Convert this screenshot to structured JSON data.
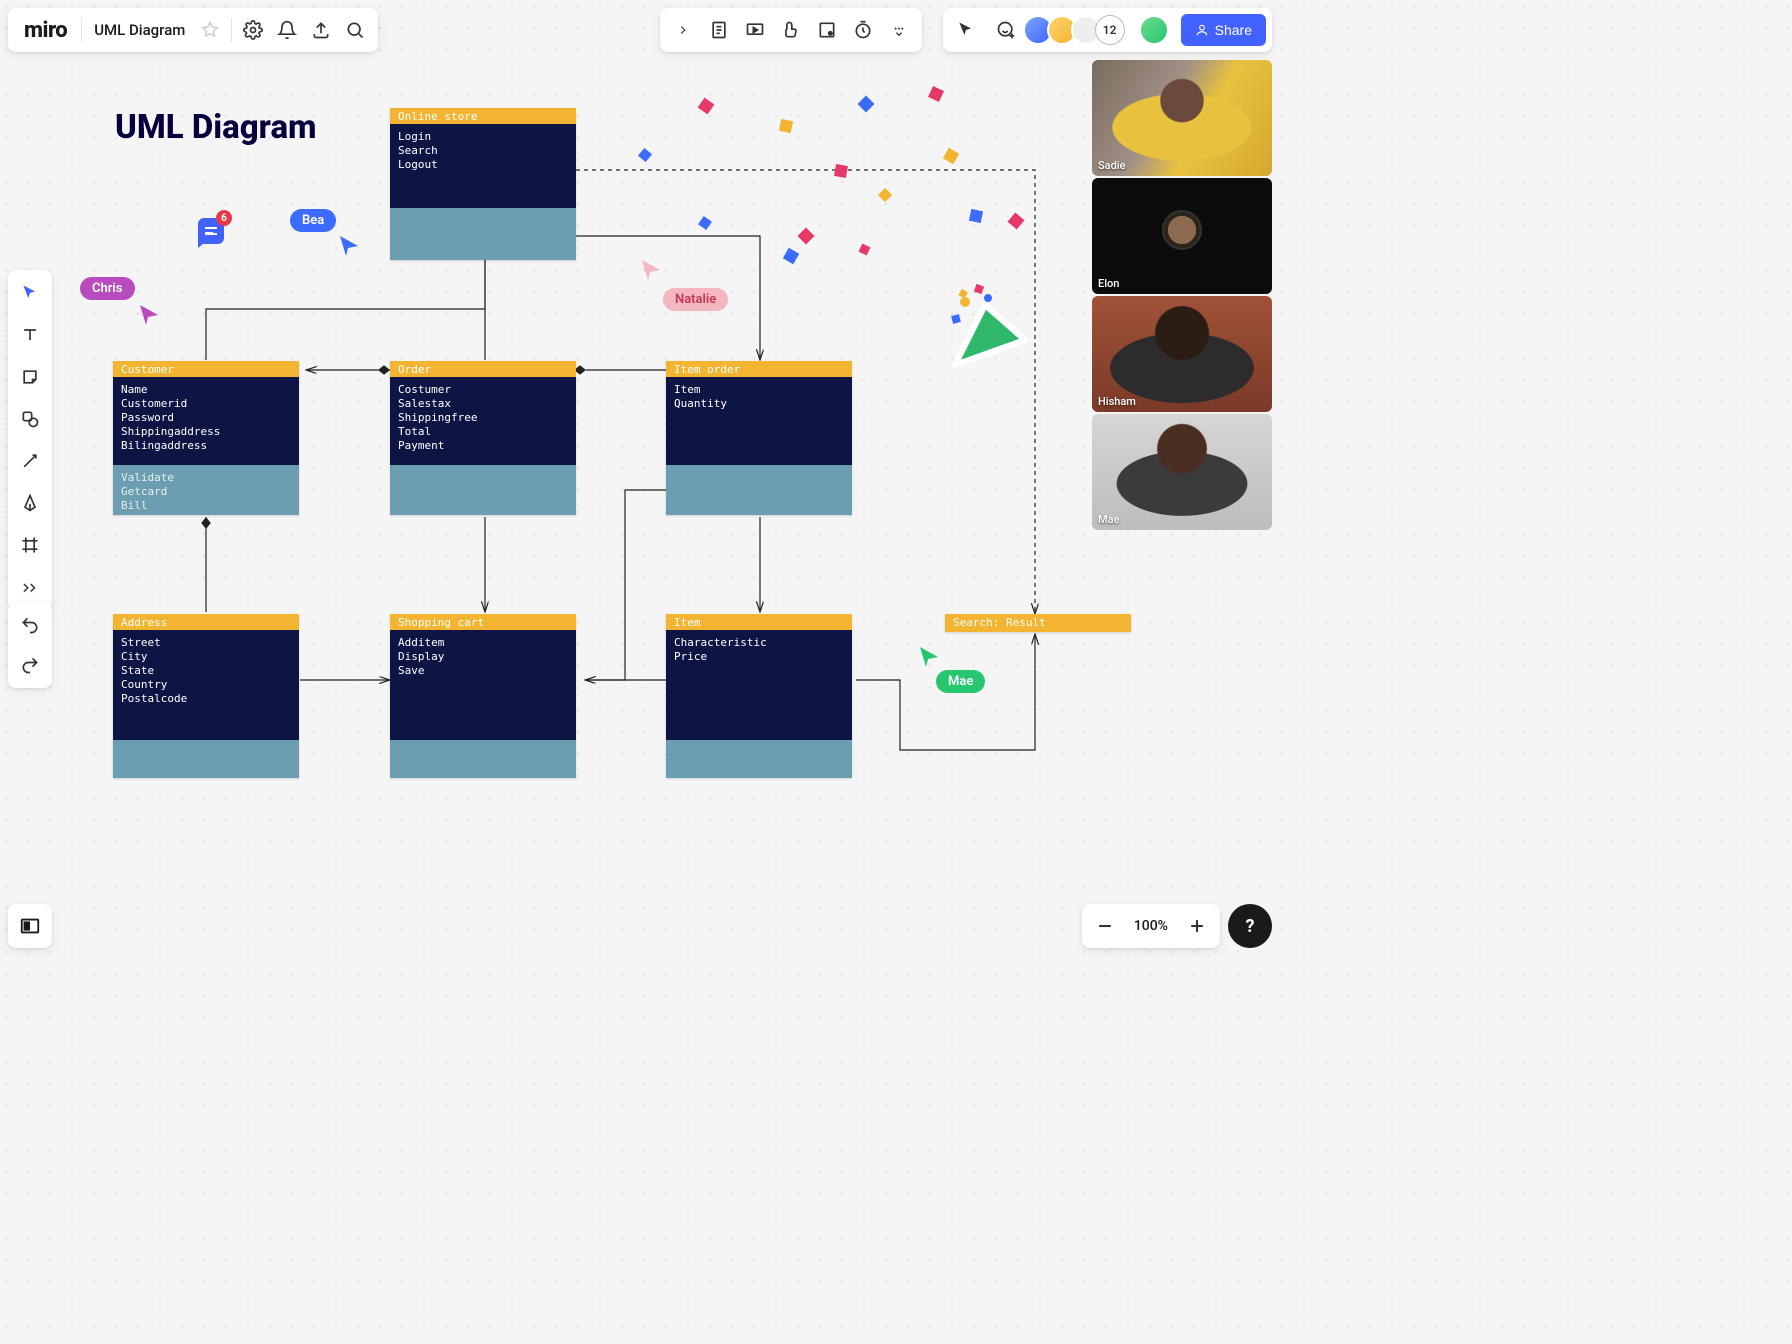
{
  "app": {
    "logo": "miro"
  },
  "board": {
    "name": "UML Diagram"
  },
  "page_title": "UML Diagram",
  "share_label": "Share",
  "avatar_overflow": "12",
  "zoom": "100%",
  "help": "?",
  "comment_count": "6",
  "cursors": {
    "bea": "Bea",
    "chris": "Chris",
    "natalie": "Natalie",
    "mae": "Mae"
  },
  "video": {
    "p1": "Sadie",
    "p2": "Elon",
    "p3": "Hisham",
    "p4": "Mae"
  },
  "uml": {
    "online_store": {
      "title": "Online store",
      "body": "Login\nSearch\nLogout"
    },
    "customer": {
      "title": "Customer",
      "body": "Name\nCustomerid\nPassword\nShippingaddress\nBilingaddress",
      "foot": "Validate\nGetcard\nBill"
    },
    "order": {
      "title": "Order",
      "body": "Costumer\nSalestax\nShippingfree\nTotal\nPayment"
    },
    "item_order": {
      "title": "Item order",
      "body": "Item\nQuantity"
    },
    "address": {
      "title": "Address",
      "body": "Street\nCity\nState\nCountry\nPostalcode"
    },
    "shopping_cart": {
      "title": "Shopping cart",
      "body": "Additem\nDisplay\nSave"
    },
    "item": {
      "title": "Item",
      "body": "Characteristic\nPrice"
    },
    "search": {
      "title": "Search: Result"
    }
  }
}
